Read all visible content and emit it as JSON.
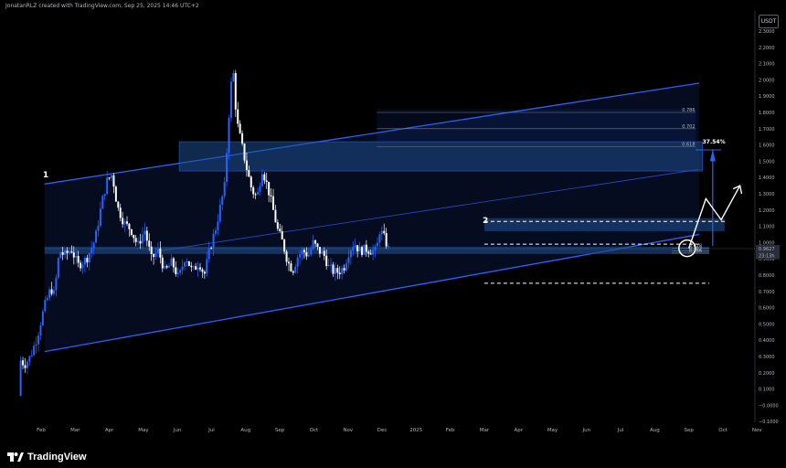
{
  "header": {
    "text": "JonatanRLZ created with TradingView.com, Sep 25, 2025 14:46 UTC+2"
  },
  "currency": "USDT",
  "brand": {
    "name": "TradingView"
  },
  "colors": {
    "bull": "#2962ff",
    "bear": "#ffffff",
    "channel": "#2962ff",
    "zone": "#1e4d8c",
    "background": "#000000"
  },
  "chart_data": {
    "type": "candlestick",
    "title": "",
    "ylim": [
      -0.15,
      2.35
    ],
    "y_ticks": [
      "2.3000",
      "2.2000",
      "2.1000",
      "2.0000",
      "1.9000",
      "1.8000",
      "1.7000",
      "1.6000",
      "1.5000",
      "1.4000",
      "1.3000",
      "1.2000",
      "1.1000",
      "1.0000",
      "0.9000",
      "0.8000",
      "0.7000",
      "0.6000",
      "0.5000",
      "0.4000",
      "0.3000",
      "0.2000",
      "0.1000",
      "−0.0000",
      "−0.1000"
    ],
    "y_tick_values": [
      2.3,
      2.2,
      2.1,
      2.0,
      1.9,
      1.8,
      1.7,
      1.6,
      1.5,
      1.4,
      1.3,
      1.2,
      1.1,
      1.0,
      0.9,
      0.8,
      0.7,
      0.6,
      0.5,
      0.4,
      0.3,
      0.2,
      0.1,
      0.0,
      -0.1
    ],
    "x_ticks": [
      "Feb",
      "Mar",
      "Apr",
      "May",
      "Jun",
      "Jul",
      "Aug",
      "Sep",
      "Oct",
      "Nov",
      "Dec",
      "2025",
      "Feb",
      "Mar",
      "Apr",
      "May",
      "Jun",
      "Jul",
      "Aug",
      "Sep",
      "Oct",
      "Nov",
      "Dec"
    ],
    "x_tick_months": [
      1,
      2,
      3,
      4,
      5,
      6,
      7,
      8,
      9,
      10,
      11,
      12,
      13,
      14,
      15,
      16,
      17,
      18,
      19,
      20,
      21,
      22,
      23
    ],
    "price_labels": [
      {
        "text": "0.9627",
        "value": 0.9627
      },
      {
        "text": "23:13h",
        "value": 0.92
      }
    ],
    "path": [
      [
        0.0,
        0.06
      ],
      [
        0.05,
        0.28
      ],
      [
        0.18,
        0.25
      ],
      [
        0.35,
        0.3
      ],
      [
        0.55,
        0.42
      ],
      [
        0.75,
        0.6
      ],
      [
        0.95,
        0.72
      ],
      [
        1.05,
        0.68
      ],
      [
        1.2,
        0.95
      ],
      [
        1.35,
        0.92
      ],
      [
        1.55,
        0.96
      ],
      [
        1.75,
        0.86
      ],
      [
        2.0,
        0.9
      ],
      [
        2.25,
        1.02
      ],
      [
        2.45,
        1.25
      ],
      [
        2.6,
        1.38
      ],
      [
        2.75,
        1.42
      ],
      [
        2.9,
        1.22
      ],
      [
        3.1,
        1.12
      ],
      [
        3.3,
        1.08
      ],
      [
        3.5,
        0.98
      ],
      [
        3.7,
        1.08
      ],
      [
        3.9,
        0.9
      ],
      [
        4.1,
        0.95
      ],
      [
        4.3,
        0.82
      ],
      [
        4.5,
        0.88
      ],
      [
        4.7,
        0.78
      ],
      [
        4.9,
        0.92
      ],
      [
        5.1,
        0.82
      ],
      [
        5.3,
        0.88
      ],
      [
        5.45,
        0.8
      ],
      [
        5.6,
        0.95
      ],
      [
        5.8,
        1.1
      ],
      [
        5.95,
        1.25
      ],
      [
        6.05,
        1.35
      ],
      [
        6.15,
        1.7
      ],
      [
        6.22,
        1.95
      ],
      [
        6.3,
        2.05
      ],
      [
        6.4,
        1.75
      ],
      [
        6.55,
        1.6
      ],
      [
        6.7,
        1.45
      ],
      [
        6.85,
        1.32
      ],
      [
        7.0,
        1.28
      ],
      [
        7.15,
        1.45
      ],
      [
        7.3,
        1.35
      ],
      [
        7.45,
        1.22
      ],
      [
        7.6,
        1.08
      ],
      [
        7.75,
        1.0
      ],
      [
        7.9,
        0.88
      ],
      [
        8.05,
        0.83
      ],
      [
        8.2,
        0.92
      ],
      [
        8.35,
        0.95
      ],
      [
        8.5,
        0.92
      ],
      [
        8.65,
        1.0
      ],
      [
        8.8,
        0.95
      ],
      [
        8.95,
        0.93
      ],
      [
        9.1,
        0.85
      ],
      [
        9.25,
        0.82
      ],
      [
        9.4,
        0.82
      ],
      [
        9.55,
        0.85
      ],
      [
        9.7,
        0.95
      ],
      [
        9.85,
        1.0
      ],
      [
        10.0,
        0.95
      ],
      [
        10.2,
        0.96
      ],
      [
        10.35,
        0.95
      ],
      [
        10.5,
        0.95
      ],
      [
        10.6,
        1.08
      ],
      [
        10.75,
        1.02
      ],
      [
        10.85,
        0.96
      ]
    ],
    "annotations": [
      {
        "text": "1",
        "x_month": 1.05,
        "y": 1.4
      },
      {
        "text": "2",
        "x_month": 13.95,
        "y": 1.12
      },
      {
        "text": "37.54%",
        "x_month": 20.4,
        "y": 1.61
      }
    ],
    "fib_levels": [
      {
        "text": "0.786",
        "value": 1.8
      },
      {
        "text": "0.702",
        "value": 1.7
      },
      {
        "text": "0.618",
        "value": 1.59
      },
      {
        "text": "0.618",
        "value": 0.965
      },
      {
        "text": "0.702",
        "value": 0.948
      },
      {
        "text": "0.786",
        "value": 0.935
      }
    ]
  }
}
